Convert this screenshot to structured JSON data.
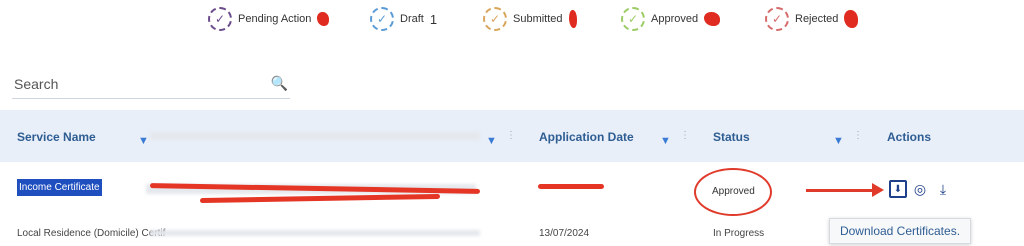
{
  "status_filters": [
    {
      "label": "Pending Action",
      "count": "",
      "icon": "check-circle-icon"
    },
    {
      "label": "Draft",
      "count": "1",
      "icon": "check-circle-icon"
    },
    {
      "label": "Submitted",
      "count": "",
      "icon": "check-circle-icon"
    },
    {
      "label": "Approved",
      "count": "",
      "icon": "check-circle-icon"
    },
    {
      "label": "Rejected",
      "count": "",
      "icon": "check-circle-icon"
    }
  ],
  "colors": {
    "header_bg": "#e9eff8",
    "header_text": "#2e5d93",
    "accent": "#3a7bd5",
    "annotation_red": "#e03a2b",
    "selection_bg": "#1f4fbf"
  },
  "search": {
    "placeholder": "Search"
  },
  "table": {
    "columns": [
      "Service Name",
      "Application Date",
      "Status",
      "Actions"
    ],
    "rows": [
      {
        "service": "Income Certificate",
        "status": "Approved"
      },
      {
        "service": "Local Residence (Domicile) Certif",
        "date": "13/07/2024",
        "status": "In Progress"
      }
    ]
  },
  "tooltip": "Download Certificates."
}
